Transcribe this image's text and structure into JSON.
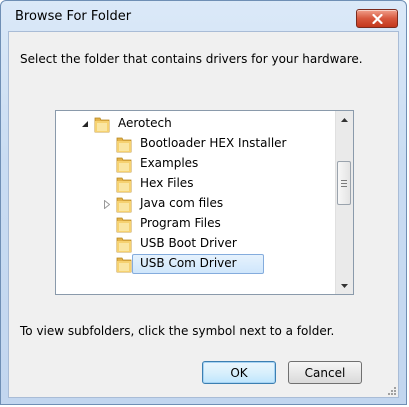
{
  "window": {
    "title": "Browse For Folder"
  },
  "dialog": {
    "description": "Select the folder that contains drivers for your hardware.",
    "hint": "To view subfolders, click the symbol next to a folder."
  },
  "tree": {
    "items": [
      {
        "label": "Aerotech",
        "expander": "expanded",
        "level": 0
      },
      {
        "label": "Bootloader HEX Installer",
        "expander": "none",
        "level": 1
      },
      {
        "label": "Examples",
        "expander": "none",
        "level": 1
      },
      {
        "label": "Hex Files",
        "expander": "none",
        "level": 1
      },
      {
        "label": "Java com files",
        "expander": "collapsed",
        "level": 1
      },
      {
        "label": "Program Files",
        "expander": "none",
        "level": 1
      },
      {
        "label": "USB Boot Driver",
        "expander": "none",
        "level": 1
      },
      {
        "label": "USB Com Driver",
        "expander": "none",
        "level": 1,
        "selected": true
      }
    ]
  },
  "buttons": {
    "ok": "OK",
    "cancel": "Cancel"
  },
  "icons": {
    "close": "close-icon",
    "folder": "folder-icon",
    "expanded": "expanded-triangle-icon",
    "collapsed": "collapsed-triangle-icon",
    "scroll_up": "scroll-up-arrow-icon",
    "scroll_down": "scroll-down-arrow-icon",
    "grip": "resize-grip-icon"
  },
  "colors": {
    "selection": "#cfe6fb",
    "close_button": "#c3381d",
    "title_bar": "#c9dcf2"
  }
}
